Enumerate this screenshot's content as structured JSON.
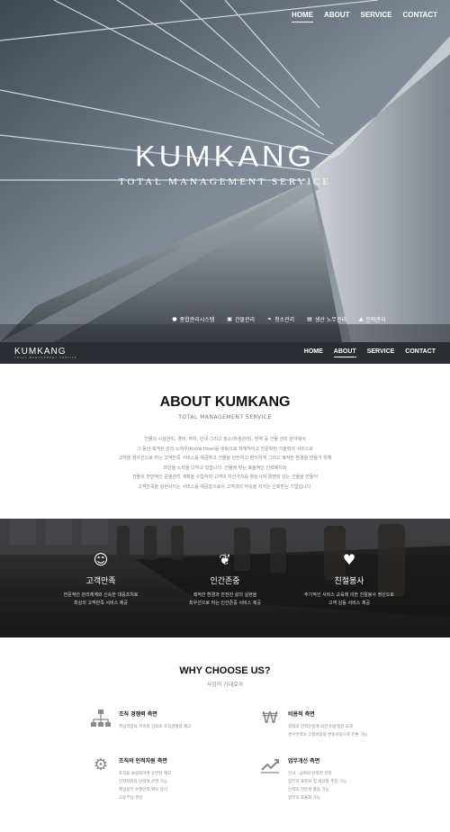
{
  "nav": {
    "items": [
      "HOME",
      "ABOUT",
      "SERVICE",
      "CONTACT"
    ],
    "active": "HOME"
  },
  "hero": {
    "logo": "KUMKANG",
    "tagline": "TOTAL MANAGEMENT SERVICE",
    "quick_links": [
      {
        "icon": "monitor-icon",
        "label": "종합관리시스템"
      },
      {
        "icon": "building-icon",
        "label": "건물관리"
      },
      {
        "icon": "leaf-icon",
        "label": "청소관리"
      },
      {
        "icon": "document-icon",
        "label": "생산 노무관리"
      },
      {
        "icon": "person-icon",
        "label": "인력관리"
      }
    ]
  },
  "bar": {
    "logo": "KUMKANG",
    "logo_sub": "TOTAL MANAGEMENT SERVICE",
    "items": [
      "HOME",
      "ABOUT",
      "SERVICE",
      "CONTACT"
    ],
    "active": "ABOUT"
  },
  "about": {
    "title": "ABOUT KUMKANG",
    "subtitle": "TOTAL MANAGEMENT SERVICE",
    "lines": [
      "건물의 시설관리, 경비, 주차, 안내 그리고 청소(위생관리), 방역 등 건물 관리 분야에서",
      "그 동안 축적된 관리 노하우(Know How)를 바탕으로 체계적이고 전문화된 기술력과 서비스로",
      "고객을 최우선으로 하는 고객만족 서비스를 제공하고 건물을 안전하고 편리하게 그리고 쾌적한 환경을 만들기 위해",
      "최선을 노력을 다하고 있습니다. 건물에 맞는 효율적인 인력배치와",
      "건물의 전반적인 운영관리 계획을 수립하여 고객의 자산가치를 향상시켜 경쟁력 있는 건물을 만들어",
      "고객만족을 실현시키는 서비스를 제공함으로서 고객과의 약속을 지키는 신뢰받는 기업입니다."
    ]
  },
  "values": [
    {
      "icon": "smile-icon",
      "title": "고객만족",
      "lines": [
        "전문적인 관리체계와 신속한 대응조치로",
        "최상의 고객만족 서비스 제공"
      ]
    },
    {
      "icon": "sprout-icon",
      "title": "인간존중",
      "lines": [
        "쾌적한 환경과 안전한 삶의 실현을",
        "최우선으로 하는 인간존중 서비스 제공"
      ]
    },
    {
      "icon": "heart-icon",
      "title": "친절봉사",
      "lines": [
        "주기적인 서비스 교육에 의한 친절봉사 정신으로",
        "고객 감동 서비스 제공"
      ]
    }
  ],
  "why": {
    "title": "WHY CHOOSE US?",
    "subtitle": "사업의 기대효과",
    "features": [
      {
        "icon": "org-chart-icon",
        "title": "조직 경쟁력 측면",
        "lines": [
          "핵심역량의 지속적 강화로 조직경쟁력 제고"
        ]
      },
      {
        "icon": "won-icon",
        "title": "비용적 측면",
        "lines": [
          "최적의 인력운용에 의한 비용절감 효과",
          "경우인력의 고정비용을 변동비용으로 전환 가능"
        ]
      },
      {
        "icon": "gears-icon",
        "title": "조직의 인적자원 측면",
        "lines": [
          "조직을 슬림화하여 유연성 제고",
          "인적자원의 탄력적 운영 가능",
          "핵심업무 수행인력 확보 용이",
          "고용부담 경감"
        ]
      },
      {
        "icon": "trend-icon",
        "title": "업무개선 측면",
        "lines": [
          "인사 · 급여의 탄력한 관리",
          "업무의 표준화 및 개선화 추진 가능",
          "인력의 전문성 활용 가능",
          "업무의 효율화 가능"
        ]
      }
    ]
  }
}
